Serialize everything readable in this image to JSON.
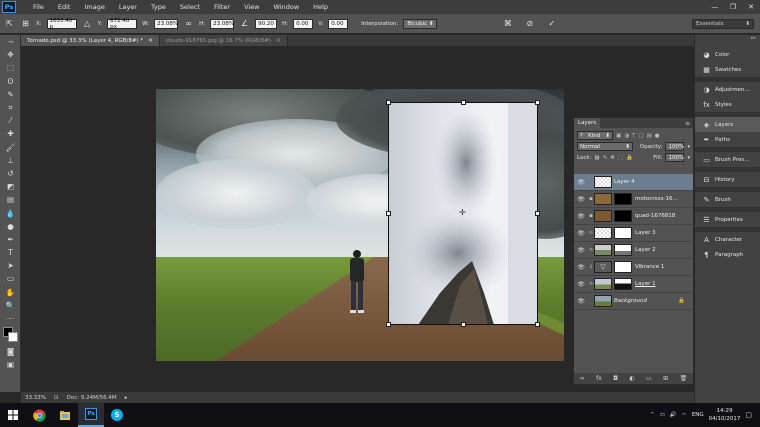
{
  "app": {
    "logo": "Ps",
    "window_controls": [
      "—",
      "❐",
      "✕"
    ]
  },
  "menu": [
    "File",
    "Edit",
    "Image",
    "Layer",
    "Type",
    "Select",
    "Filter",
    "View",
    "Window",
    "Help"
  ],
  "options": {
    "x_label": "X:",
    "x_value": "1655.40 p",
    "y_label": "Y:",
    "y_value": "672.40 px",
    "w_label": "W:",
    "w_value": "23.08%",
    "h_label": "H:",
    "h_value": "23.08%",
    "angle_value": "90.20",
    "hskew_label": "H:",
    "hskew_value": "0.00",
    "vskew_label": "V:",
    "vskew_value": "0.00",
    "interp_label": "Interpolation:",
    "interp_value": "Bicubic",
    "workspace": "Essentials"
  },
  "tabs": [
    {
      "label": "Tornado.psd @ 33.3% (Layer 4, RGB/8#) *",
      "active": true
    },
    {
      "label": "clouds-918765.jpg @ 16.7% (RGB/8#)",
      "active": false
    }
  ],
  "status": {
    "zoom": "33.33%",
    "doc": "Doc: 9.24M/56.4M"
  },
  "layers_panel": {
    "tab": "Layers",
    "filter": "Kind",
    "blend_mode": "Normal",
    "opacity_label": "Opacity:",
    "opacity_value": "100%",
    "lock_label": "Lock:",
    "fill_label": "Fill:",
    "fill_value": "100%",
    "layers": [
      {
        "name": "Layer 4",
        "selected": true,
        "thumb": "#cfd6de",
        "mask": ""
      },
      {
        "name": "motocross-16...",
        "selected": false,
        "thumb": "#8a6a3a",
        "mask": "#000000"
      },
      {
        "name": "quad-1676818",
        "selected": false,
        "thumb": "#7a5a30",
        "mask": "#000000"
      },
      {
        "name": "Layer 3",
        "selected": false,
        "thumb": "#b9c2c9",
        "mask": "#ffffff"
      },
      {
        "name": "Layer 2",
        "selected": false,
        "thumb": "#9aa39a",
        "mask": "#e8e8e8"
      },
      {
        "name": "Vibrance 1",
        "selected": false,
        "thumb": "#555555",
        "mask": "#ffffff"
      },
      {
        "name": "Layer 1",
        "selected": false,
        "thumb": "#a8b4bc",
        "mask": "#2a2a2a"
      },
      {
        "name": "Background",
        "selected": false,
        "thumb": "#6f8a9a",
        "mask": ""
      }
    ]
  },
  "dock": [
    {
      "label": "Color",
      "icon": "color-icon"
    },
    {
      "label": "Swatches",
      "icon": "swatches-icon"
    },
    {
      "label": "Adjustmen...",
      "icon": "adjustments-icon"
    },
    {
      "label": "Styles",
      "icon": "styles-icon"
    },
    {
      "label": "Layers",
      "icon": "layers-icon"
    },
    {
      "label": "Paths",
      "icon": "paths-icon"
    },
    {
      "label": "Brush Pres...",
      "icon": "brush-presets-icon"
    },
    {
      "label": "History",
      "icon": "history-icon"
    },
    {
      "label": "Brush",
      "icon": "brush-icon"
    },
    {
      "label": "Properties",
      "icon": "properties-icon"
    },
    {
      "label": "Character",
      "icon": "character-icon"
    },
    {
      "label": "Paragraph",
      "icon": "paragraph-icon"
    }
  ],
  "taskbar": {
    "language": "ENG",
    "time": "14:29",
    "date": "04/10/2017"
  },
  "colors": {
    "accent": "#3b95e8",
    "selection": "#6c7d8f",
    "panel": "#535353"
  }
}
